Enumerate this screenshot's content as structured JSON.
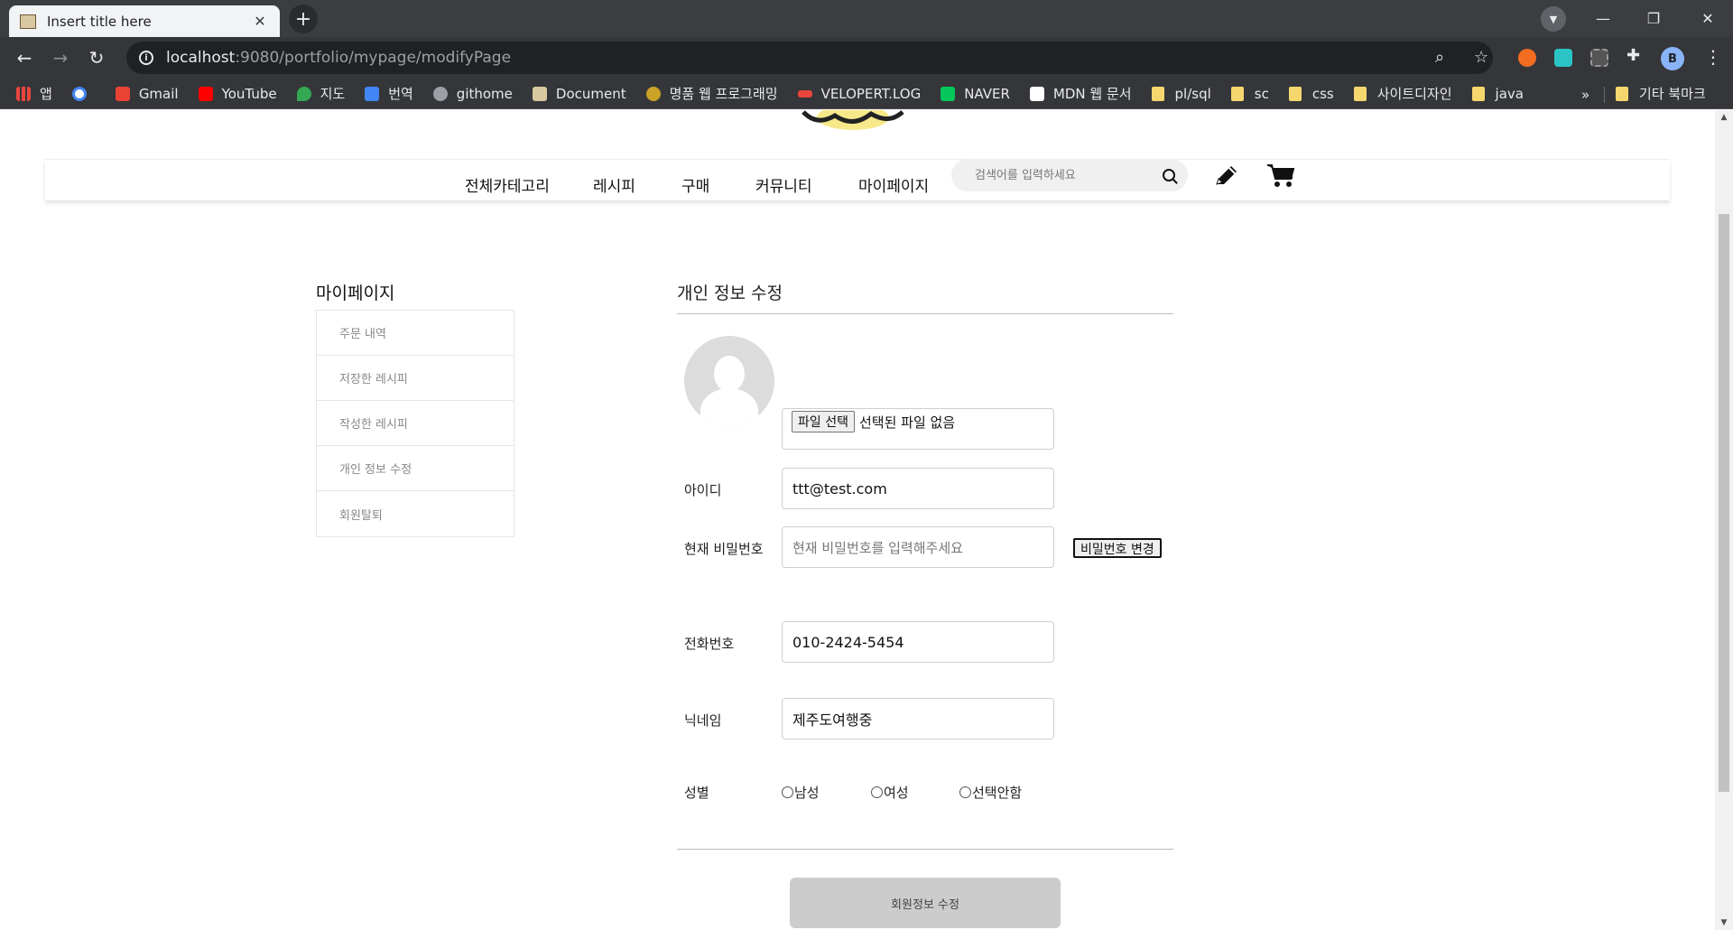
{
  "browser": {
    "tab_title": "Insert title here",
    "tab_close": "✕",
    "new_tab": "+",
    "url_host": "localhost",
    "url_path": ":9080/portfolio/mypage/modifyPage",
    "profile_initial": "B",
    "window_controls": [
      "—",
      "❐",
      "✕"
    ],
    "bookmarks": [
      {
        "label": "앱",
        "icon": "apps-grid-icon",
        "color": "#e8453c"
      },
      {
        "label": "",
        "icon": "google-icon",
        "color": "#4285f4"
      },
      {
        "label": "Gmail",
        "icon": "gmail-icon",
        "color": "#ea4335"
      },
      {
        "label": "YouTube",
        "icon": "youtube-icon",
        "color": "#ff0000"
      },
      {
        "label": "지도",
        "icon": "maps-icon",
        "color": "#34a853"
      },
      {
        "label": "번역",
        "icon": "translate-icon",
        "color": "#4285f4"
      },
      {
        "label": "githome",
        "icon": "globe-icon",
        "color": "#9aa0a6"
      },
      {
        "label": "Document",
        "icon": "document-icon",
        "color": "#d9c7a0"
      },
      {
        "label": "명품 웹 프로그래밍",
        "icon": "book-icon",
        "color": "#c9a227"
      },
      {
        "label": "VELOPERT.LOG",
        "icon": "velopert-icon",
        "color": "#e8453c"
      },
      {
        "label": "NAVER",
        "icon": "naver-icon",
        "color": "#03c75a"
      },
      {
        "label": "MDN 웹 문서",
        "icon": "mdn-icon",
        "color": "#ffffff"
      },
      {
        "label": "pl/sql",
        "icon": "folder-icon",
        "color": "#f5d76e"
      },
      {
        "label": "sc",
        "icon": "folder-icon",
        "color": "#f5d76e"
      },
      {
        "label": "css",
        "icon": "folder-icon",
        "color": "#f5d76e"
      },
      {
        "label": "사이트디자인",
        "icon": "folder-icon",
        "color": "#f5d76e"
      },
      {
        "label": "java",
        "icon": "folder-icon",
        "color": "#f5d76e"
      }
    ],
    "bookmarks_more": "»",
    "other_bookmarks": "기타 북마크"
  },
  "nav": {
    "items": [
      "전체카테고리",
      "레시피",
      "구매",
      "커뮤니티",
      "마이페이지"
    ],
    "search_placeholder": "검색어를 입력하세요"
  },
  "sidebar": {
    "title": "마이페이지",
    "items": [
      "주문 내역",
      "저장한 레시피",
      "작성한 레시피",
      "개인 정보 수정",
      "회원탈퇴"
    ]
  },
  "form": {
    "title": "개인 정보 수정",
    "file_button": "파일 선택",
    "file_status": "선택된 파일 없음",
    "id_label": "아이디",
    "id_value": "ttt@test.com",
    "password_label": "현재 비밀번호",
    "password_placeholder": "현재 비밀번호를 입력해주세요",
    "password_change_button": "비밀번호 변경",
    "phone_label": "전화번호",
    "phone_value": "010-2424-5454",
    "nickname_label": "닉네임",
    "nickname_value": "제주도여행중",
    "gender_label": "성별",
    "gender_options": [
      "남성",
      "여성",
      "선택안함"
    ],
    "submit_label": "회원정보 수정"
  },
  "colors": {
    "chrome_dark": "#3c3d41",
    "submit_bg": "#cccccc",
    "avatar_bg": "#dcdcdc"
  }
}
